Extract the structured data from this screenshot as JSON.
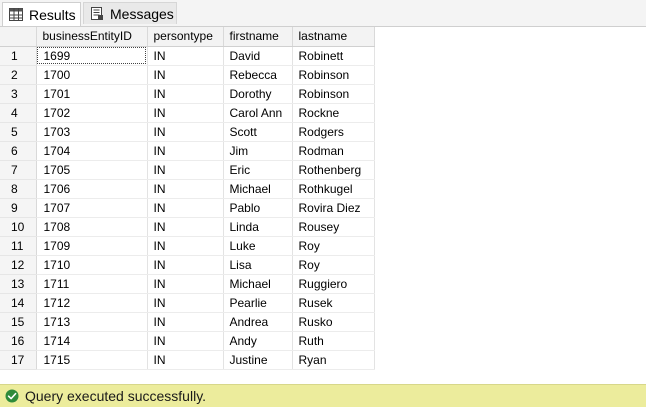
{
  "tabs": [
    {
      "label": "Results",
      "icon": "grid-icon",
      "active": true
    },
    {
      "label": "Messages",
      "icon": "messages-icon",
      "active": false
    }
  ],
  "grid": {
    "columns": [
      "businessEntityID",
      "persontype",
      "firstname",
      "lastname"
    ],
    "rows": [
      {
        "n": "1",
        "id": "1699",
        "type": "IN",
        "first": "David",
        "last": "Robinett"
      },
      {
        "n": "2",
        "id": "1700",
        "type": "IN",
        "first": "Rebecca",
        "last": "Robinson"
      },
      {
        "n": "3",
        "id": "1701",
        "type": "IN",
        "first": "Dorothy",
        "last": "Robinson"
      },
      {
        "n": "4",
        "id": "1702",
        "type": "IN",
        "first": "Carol Ann",
        "last": "Rockne"
      },
      {
        "n": "5",
        "id": "1703",
        "type": "IN",
        "first": "Scott",
        "last": "Rodgers"
      },
      {
        "n": "6",
        "id": "1704",
        "type": "IN",
        "first": "Jim",
        "last": "Rodman"
      },
      {
        "n": "7",
        "id": "1705",
        "type": "IN",
        "first": "Eric",
        "last": "Rothenberg"
      },
      {
        "n": "8",
        "id": "1706",
        "type": "IN",
        "first": "Michael",
        "last": "Rothkugel"
      },
      {
        "n": "9",
        "id": "1707",
        "type": "IN",
        "first": "Pablo",
        "last": "Rovira Diez"
      },
      {
        "n": "10",
        "id": "1708",
        "type": "IN",
        "first": "Linda",
        "last": "Rousey"
      },
      {
        "n": "11",
        "id": "1709",
        "type": "IN",
        "first": "Luke",
        "last": "Roy"
      },
      {
        "n": "12",
        "id": "1710",
        "type": "IN",
        "first": "Lisa",
        "last": "Roy"
      },
      {
        "n": "13",
        "id": "1711",
        "type": "IN",
        "first": "Michael",
        "last": "Ruggiero"
      },
      {
        "n": "14",
        "id": "1712",
        "type": "IN",
        "first": "Pearlie",
        "last": "Rusek"
      },
      {
        "n": "15",
        "id": "1713",
        "type": "IN",
        "first": "Andrea",
        "last": "Rusko"
      },
      {
        "n": "16",
        "id": "1714",
        "type": "IN",
        "first": "Andy",
        "last": "Ruth"
      },
      {
        "n": "17",
        "id": "1715",
        "type": "IN",
        "first": "Justine",
        "last": "Ryan"
      }
    ]
  },
  "status": {
    "icon": "check-circle-icon",
    "text": "Query executed successfully.",
    "color": "#ecec9c",
    "icon_color": "#2e8b3a"
  }
}
